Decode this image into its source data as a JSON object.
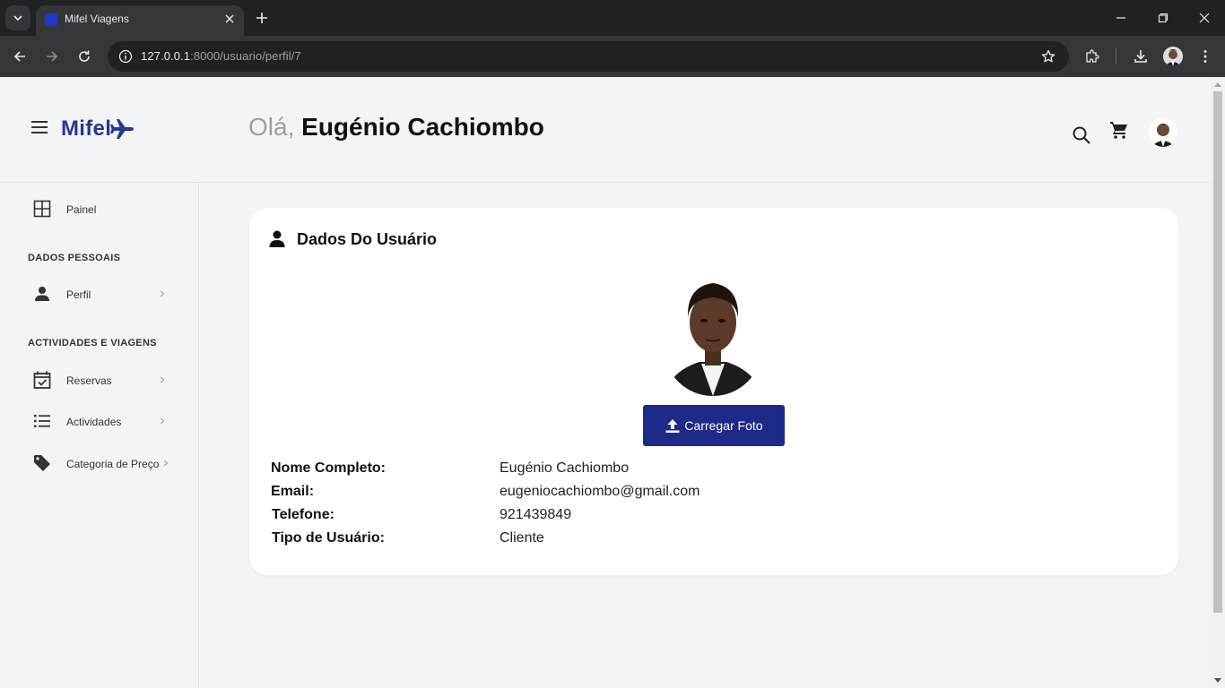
{
  "browser": {
    "tab_title": "Mifel Viagens",
    "url_host": "127.0.0.1",
    "url_rest": ":8000/usuario/perfil/7"
  },
  "header": {
    "logo_text": "Mifel",
    "greeting_hello": "Olá,",
    "greeting_name": "Eugénio Cachiombo"
  },
  "sidebar": {
    "painel": "Painel",
    "section_personal": "DADOS PESSOAIS",
    "perfil": "Perfil",
    "section_activities": "ACTIVIDADES E VIAGENS",
    "reservas": "Reservas",
    "actividades": "Actividades",
    "categoria": "Categoria de Preço"
  },
  "card": {
    "title": "Dados Do Usuário",
    "upload_label": "Carregar Foto",
    "fields": [
      {
        "key": "Nome Completo:",
        "value": "Eugénio Cachiombo"
      },
      {
        "key": "Email:",
        "value": "eugeniocachiombo@gmail.com"
      },
      {
        "key": "Telefone:",
        "value": "921439849"
      },
      {
        "key": "Tipo de Usuário:",
        "value": "Cliente"
      }
    ]
  },
  "colors": {
    "brand": "#233a8a",
    "button": "#1e2a8a",
    "page_bg": "#f3f4f6"
  },
  "icons": [
    "chevron-down-icon",
    "close-icon",
    "plus-icon",
    "minimize-icon",
    "restore-icon",
    "back-icon",
    "forward-icon",
    "reload-icon",
    "info-icon",
    "star-icon",
    "extensions-icon",
    "download-icon",
    "kebab-menu-icon",
    "menu-icon",
    "airplane-icon",
    "search-icon",
    "cart-icon",
    "grid-icon",
    "person-icon",
    "calendar-check-icon",
    "list-icon",
    "tag-icon",
    "chevron-right-icon",
    "upload-icon"
  ]
}
